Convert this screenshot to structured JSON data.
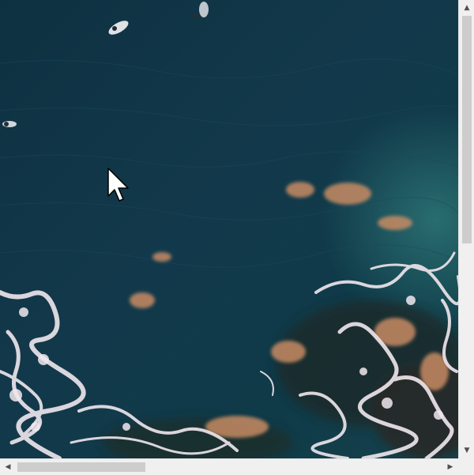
{
  "image": {
    "subject": "aerial-ocean-waves-surfers",
    "colors": {
      "deep_water": "#0f3446",
      "mid_water": "#144559",
      "foam": "#e8dfe6",
      "sunlit_rock": "#c48a62"
    }
  },
  "scrollbars": {
    "vertical": {
      "up_icon": "▲",
      "down_icon": "▼",
      "position": 0.0
    },
    "horizontal": {
      "left_icon": "◀",
      "right_icon": "▶",
      "position": 0.0
    }
  },
  "cursor": {
    "icon": "mouse-pointer-icon"
  }
}
